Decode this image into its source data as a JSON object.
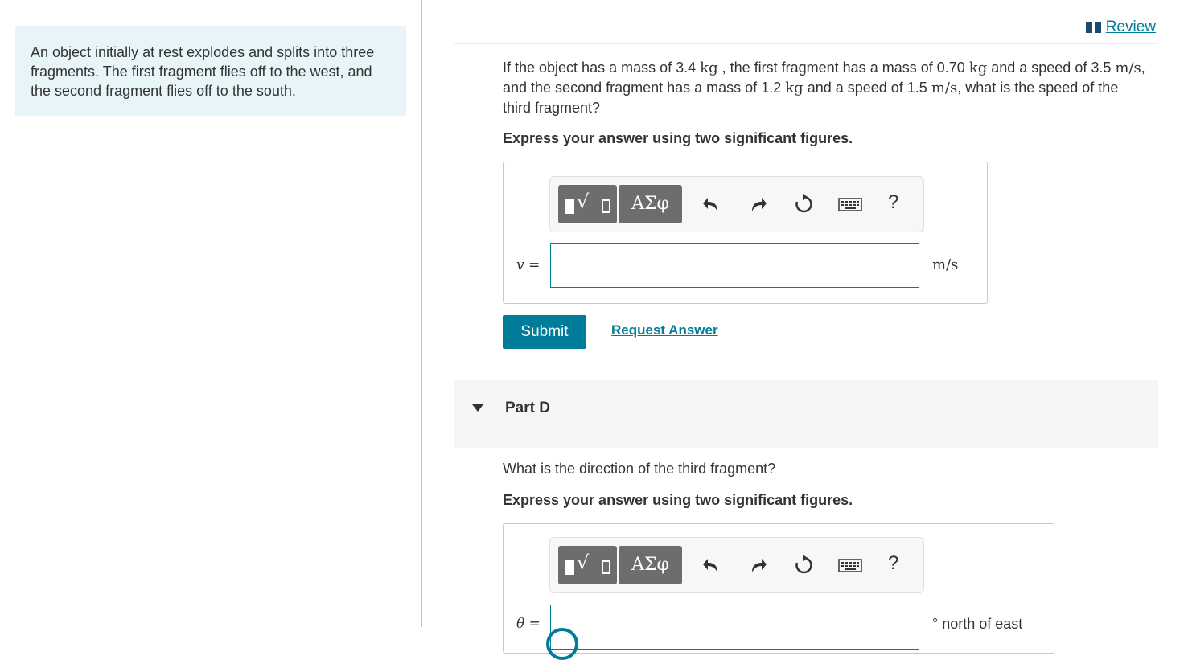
{
  "context": {
    "text": "An object initially at rest explodes and splits into three fragments. The first fragment flies off to the west, and the second fragment flies off to the south."
  },
  "review": {
    "label": "Review"
  },
  "question_c": {
    "t1": "If the object has a mass of 3.4",
    "u1": "kg",
    "t2": ", the first fragment has a mass of 0.70",
    "u2": "kg",
    "t3": "and a speed of 3.5",
    "u3": "m/s",
    "t4": ", and the second fragment has a mass of 1.2",
    "u4": "kg",
    "t5": "and a speed of 1.5",
    "u5": "m/s",
    "t6": ", what is the speed of the third fragment?"
  },
  "instruction_c": "Express your answer using two significant figures.",
  "toolbar": {
    "greek_label": "ΑΣφ",
    "help_label": "?"
  },
  "answer_c": {
    "variable": "v =",
    "value": "",
    "unit": "m/s"
  },
  "buttons": {
    "submit": "Submit",
    "request": "Request Answer"
  },
  "part_d": {
    "title": "Part D",
    "question": "What is the direction of the third fragment?",
    "instruction": "Express your answer using two significant figures.",
    "variable": "θ =",
    "value": "",
    "unit": "° north of east"
  }
}
